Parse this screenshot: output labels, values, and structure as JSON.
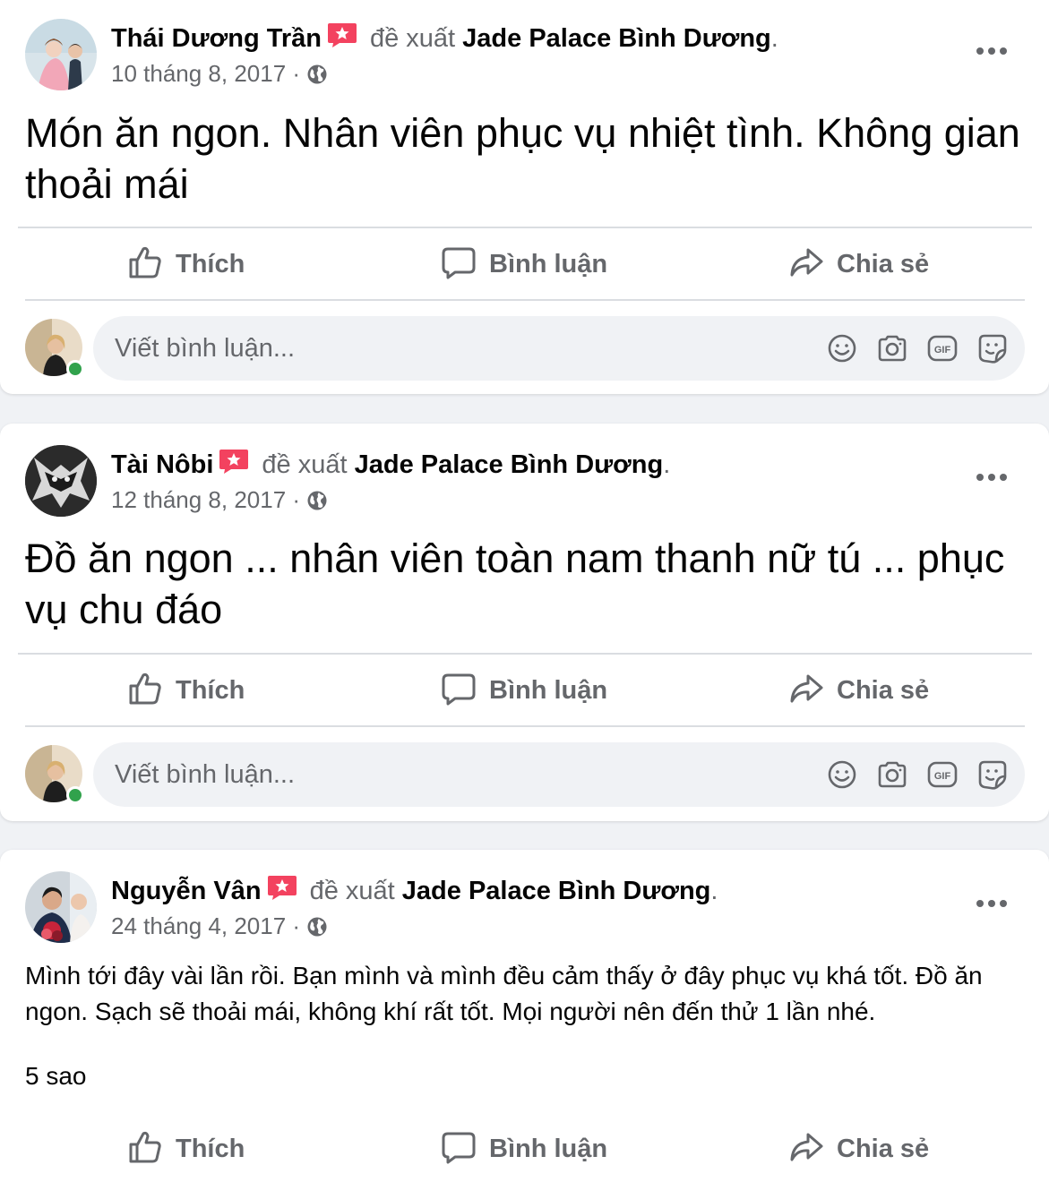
{
  "common": {
    "recommends": "đề xuất",
    "page_name": "Jade Palace Bình Dương",
    "period": ".",
    "date_sep": " ·",
    "like_label": "Thích",
    "comment_label": "Bình luận",
    "share_label": "Chia sẻ",
    "comment_placeholder": "Viết bình luận..."
  },
  "posts": [
    {
      "author": "Thái Dương Trần",
      "date": "10 tháng 8, 2017",
      "text": "Món ăn ngon. Nhân viên phục vụ nhiệt tình. Không gian thoải mái"
    },
    {
      "author": "Tài Nôbi",
      "date": "12 tháng 8, 2017",
      "text": "Đồ ăn ngon ... nhân viên toàn nam thanh nữ tú ... phục vụ chu đáo"
    },
    {
      "author": "Nguyễn Vân",
      "date": "24 tháng 4, 2017",
      "text": "Mình tới đây vài lần rồi. Bạn mình và mình đều cảm thấy ở đây phục vụ khá tốt. Đồ ăn ngon. Sạch sẽ thoải mái, không khí rất tốt. Mọi người nên đến thử 1 lần nhé.",
      "rating": "5 sao"
    }
  ],
  "icons": {
    "recommend_badge": "recommend-star-icon",
    "privacy": "globe-icon",
    "more": "more-horizontal-icon",
    "like": "thumbs-up-icon",
    "comment": "speech-bubble-icon",
    "share": "share-arrow-icon",
    "emoji": "smiley-icon",
    "camera": "camera-icon",
    "gif": "gif-icon",
    "sticker": "sticker-icon"
  },
  "colors": {
    "recommend_badge": "#f3425f",
    "online": "#31a24c",
    "secondary_text": "#65676b"
  }
}
